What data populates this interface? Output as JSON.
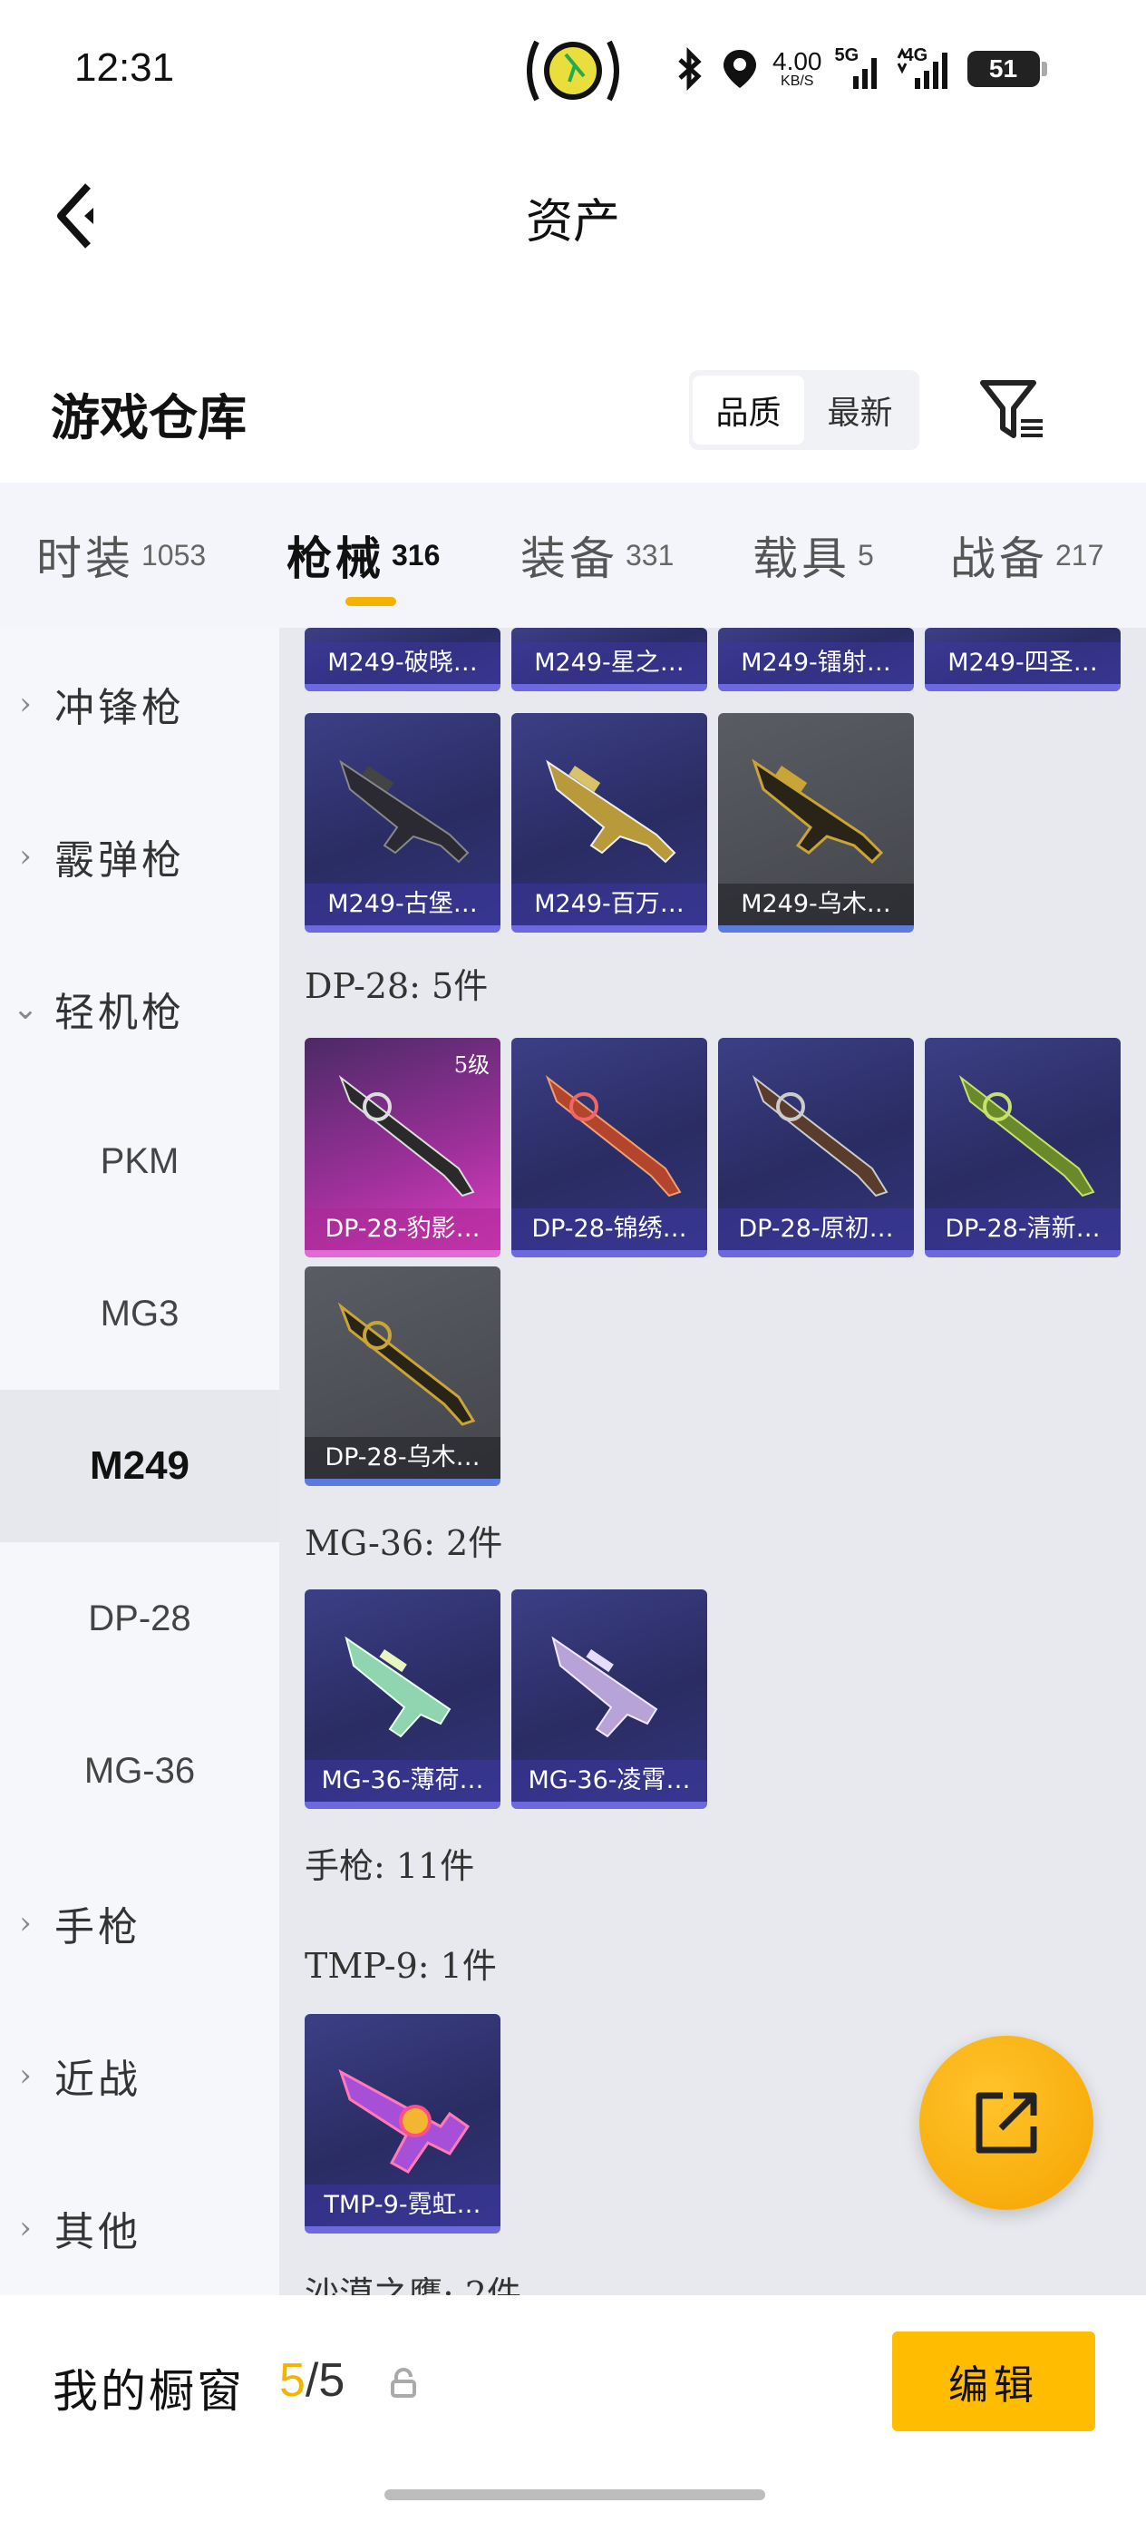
{
  "status": {
    "time": "12:31",
    "speed_value": "4.00",
    "speed_unit": "KB/S",
    "net1": "5G",
    "net2": "4G",
    "battery": "51"
  },
  "header": {
    "title": "资产"
  },
  "section": {
    "title": "游戏仓库",
    "sort_quality": "品质",
    "sort_latest": "最新"
  },
  "tabs": [
    {
      "name": "时装",
      "count": "1053"
    },
    {
      "name": "枪械",
      "count": "316"
    },
    {
      "name": "装备",
      "count": "331"
    },
    {
      "name": "载具",
      "count": "5"
    },
    {
      "name": "战备",
      "count": "217"
    }
  ],
  "sidebar": {
    "items": [
      "冲锋枪",
      "霰弹枪",
      "轻机枪",
      "PKM",
      "MG3",
      "M249",
      "DP-28",
      "MG-36",
      "手枪",
      "近战",
      "其他"
    ]
  },
  "content": {
    "top_row": [
      "M249-破晓…",
      "M249-星之…",
      "M249-镭射…",
      "M249-四圣…"
    ],
    "m249_row": [
      "M249-古堡…",
      "M249-百万…",
      "M249-乌木…"
    ],
    "dp28_header": "DP-28: 5件",
    "dp28_items": [
      "DP-28-豹影…",
      "DP-28-锦绣…",
      "DP-28-原初…",
      "DP-28-清新…",
      "DP-28-乌木…"
    ],
    "dp28_level": "5级",
    "mg36_header": "MG-36: 2件",
    "mg36_items": [
      "MG-36-薄荷…",
      "MG-36-凌霄…"
    ],
    "pistol_header": "手枪: 11件",
    "tmp9_header": "TMP-9: 1件",
    "tmp9_items": [
      "TMP-9-霓虹…"
    ],
    "desert_header": "沙漠之鹰: 2件"
  },
  "bottom": {
    "title": "我的橱窗",
    "count": "5",
    "total": "/5",
    "edit": "编辑"
  },
  "colors": {
    "accent": "#f5b300",
    "card_blue": "#2a2c63",
    "card_pink": "#e040c0"
  }
}
